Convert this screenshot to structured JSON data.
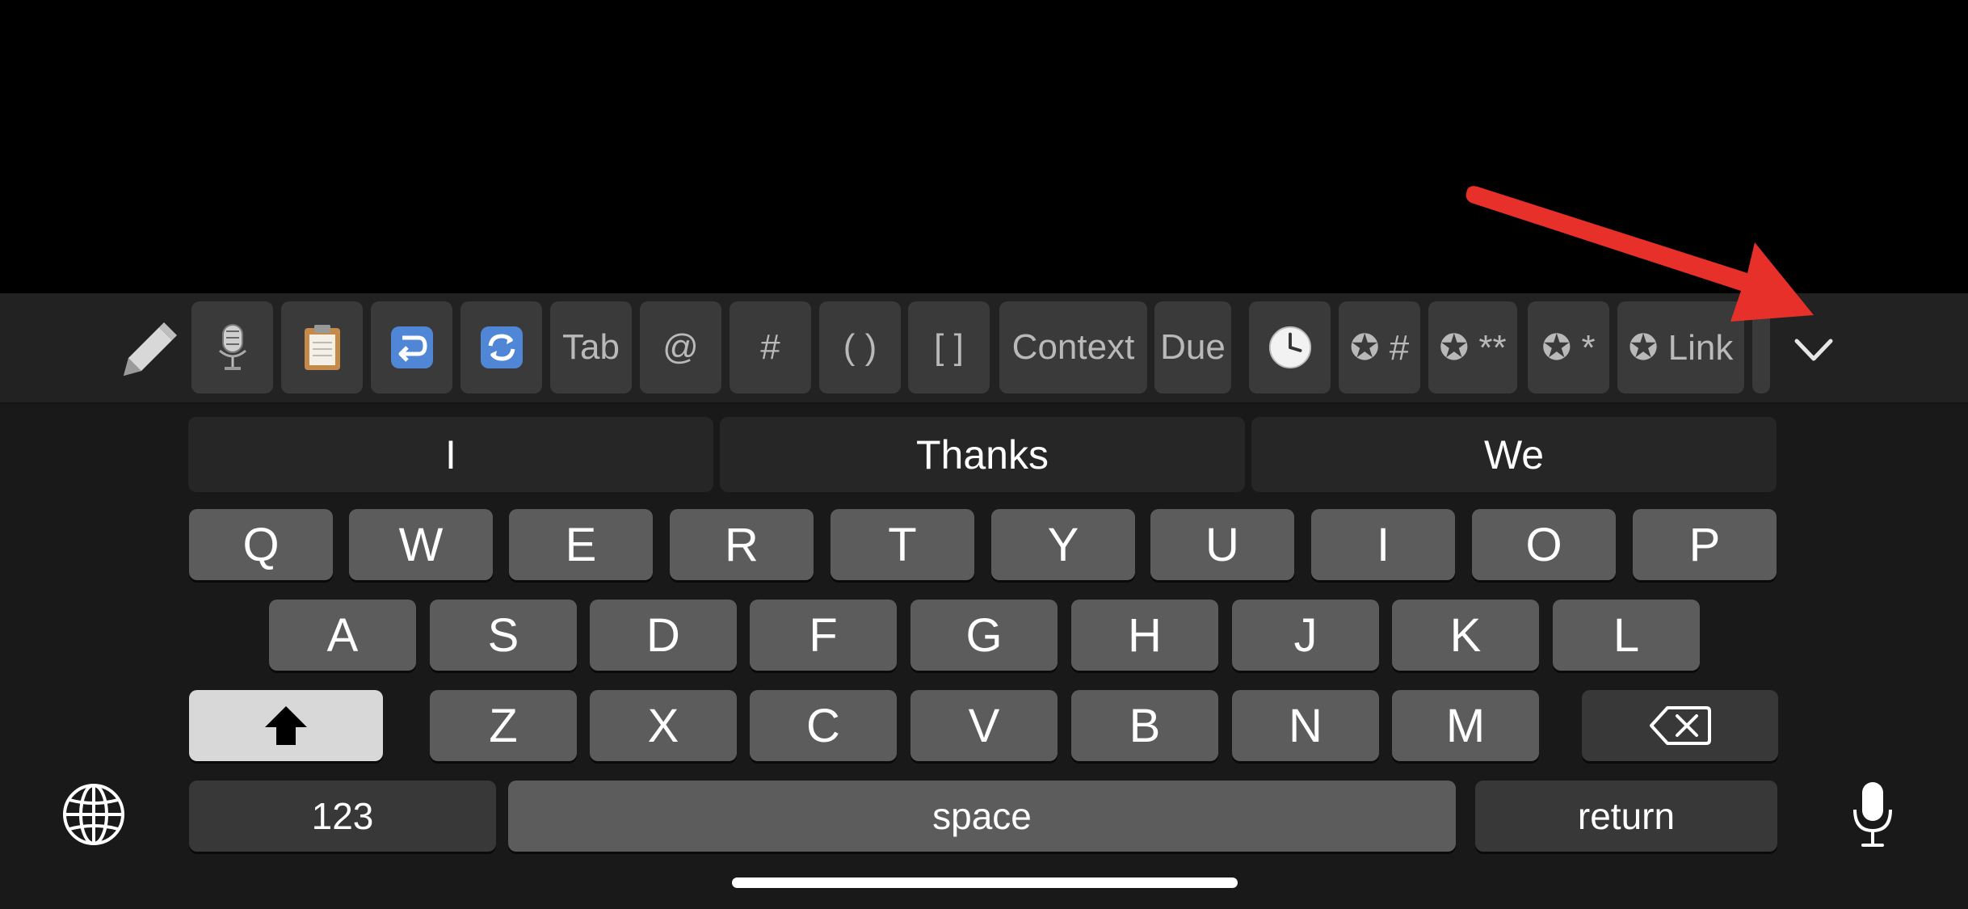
{
  "toolbar": {
    "buttons": [
      {
        "name": "microphone-emoji-button",
        "label": "",
        "icon": "studio-microphone-icon"
      },
      {
        "name": "clipboard-button",
        "label": "",
        "icon": "clipboard-icon"
      },
      {
        "name": "undo-button",
        "label": "",
        "icon": "return-arrow-icon"
      },
      {
        "name": "refresh-button",
        "label": "",
        "icon": "cycle-arrows-icon"
      },
      {
        "name": "tab-button",
        "label": "Tab"
      },
      {
        "name": "at-button",
        "label": "@"
      },
      {
        "name": "hash-button",
        "label": "#"
      },
      {
        "name": "parens-button",
        "label": "( )"
      },
      {
        "name": "brackets-button",
        "label": "[ ]"
      },
      {
        "name": "context-button",
        "label": "Context"
      },
      {
        "name": "due-button",
        "label": "Due"
      },
      {
        "name": "clock-button",
        "label": "",
        "icon": "clock-icon"
      },
      {
        "name": "star-hash-button",
        "label": "✪ #"
      },
      {
        "name": "star-bold-button",
        "label": "✪ **"
      },
      {
        "name": "star-italic-button",
        "label": "✪ *"
      },
      {
        "name": "star-link-button",
        "label": "✪ Link"
      }
    ]
  },
  "suggestions": [
    "I",
    "Thanks",
    "We"
  ],
  "rows": {
    "row1": [
      "Q",
      "W",
      "E",
      "R",
      "T",
      "Y",
      "U",
      "I",
      "O",
      "P"
    ],
    "row2": [
      "A",
      "S",
      "D",
      "F",
      "G",
      "H",
      "J",
      "K",
      "L"
    ],
    "row3": [
      "Z",
      "X",
      "C",
      "V",
      "B",
      "N",
      "M"
    ]
  },
  "bottom": {
    "numbers_label": "123",
    "space_label": "space",
    "return_label": "return"
  },
  "colors": {
    "annotation_arrow": "#e8302a",
    "keyboard_bg": "#191919",
    "key_bg": "#5c5c5c"
  }
}
